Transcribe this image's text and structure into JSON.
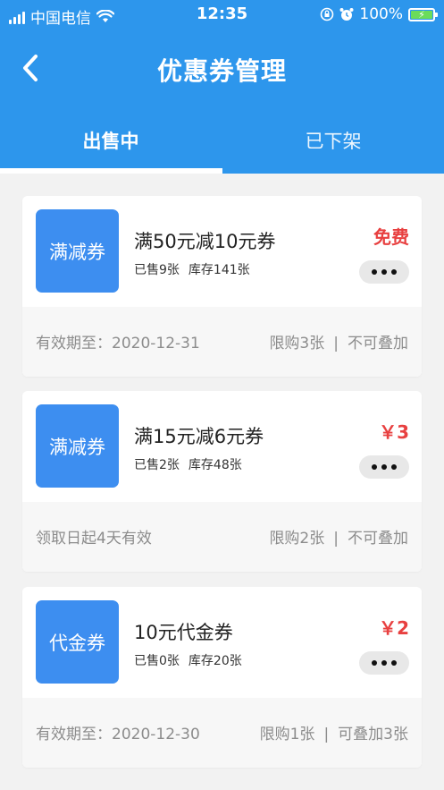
{
  "status_bar": {
    "carrier": "中国电信",
    "time": "12:35",
    "battery": "100%"
  },
  "header": {
    "title": "优惠券管理"
  },
  "tabs": [
    {
      "label": "出售中",
      "active": true
    },
    {
      "label": "已下架",
      "active": false
    }
  ],
  "coupons": [
    {
      "badge": "满减券",
      "title": "满50元减10元券",
      "sold": "已售9张",
      "stock": "库存141张",
      "price": "免费",
      "validity": "有效期至：2020-12-31",
      "limit": "限购3张",
      "stacking": "不可叠加"
    },
    {
      "badge": "满减券",
      "title": "满15元减6元券",
      "sold": "已售2张",
      "stock": "库存48张",
      "price": "￥3",
      "validity": "领取日起4天有效",
      "limit": "限购2张",
      "stacking": "不可叠加"
    },
    {
      "badge": "代金券",
      "title": "10元代金券",
      "sold": "已售0张",
      "stock": "库存20张",
      "price": "￥2",
      "validity": "有效期至：2020-12-30",
      "limit": "限购1张",
      "stacking": "可叠加3张"
    }
  ],
  "separator": "|",
  "colors": {
    "header_bg": "#2d96ec",
    "badge_bg": "#3d8ef0",
    "price": "#e84040"
  },
  "icons": [
    "signal-icon",
    "wifi-icon",
    "lock-rotation-icon",
    "alarm-icon",
    "battery-charging-icon",
    "back-arrow-icon",
    "more-icon"
  ]
}
